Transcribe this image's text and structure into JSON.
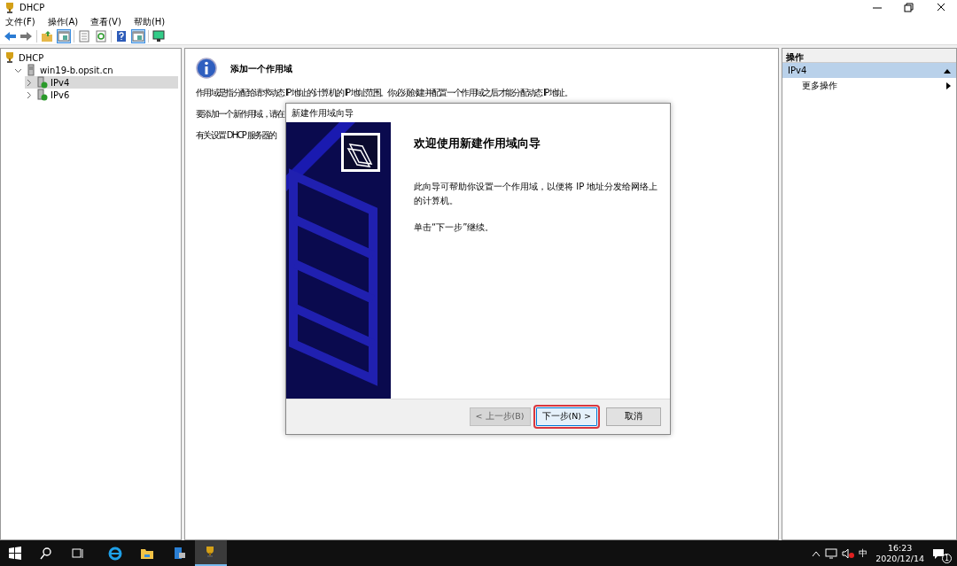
{
  "window": {
    "title": "DHCP"
  },
  "menu": [
    "文件(F)",
    "操作(A)",
    "查看(V)",
    "帮助(H)"
  ],
  "toolbar": [
    {
      "kind": "back",
      "pressed": false
    },
    {
      "kind": "forward",
      "pressed": false
    },
    {
      "kind": "sep"
    },
    {
      "kind": "up",
      "pressed": false
    },
    {
      "kind": "pane",
      "pressed": true
    },
    {
      "kind": "sep"
    },
    {
      "kind": "export",
      "pressed": false
    },
    {
      "kind": "refresh",
      "pressed": false
    },
    {
      "kind": "sep"
    },
    {
      "kind": "help",
      "pressed": false
    },
    {
      "kind": "pane",
      "pressed": true
    },
    {
      "kind": "sep"
    },
    {
      "kind": "monitor",
      "pressed": false
    }
  ],
  "tree": [
    {
      "label": "DHCP",
      "kind": "root",
      "selected": false,
      "children": [
        {
          "label": "win19-b.opsit.cn",
          "kind": "server",
          "selected": false,
          "expanded": true,
          "children": [
            {
              "label": "IPv4",
              "kind": "scope",
              "selected": true,
              "expanded": false
            },
            {
              "label": "IPv6",
              "kind": "scope",
              "selected": false,
              "expanded": false
            }
          ]
        }
      ]
    }
  ],
  "content": {
    "heading": "添加一个作用域",
    "paragraphs": [
      "作用域是指分配给请求动态 IP 地址的计算机的 IP 地址范围。你必须创建并配置一个作用域之后才能分配动态 IP 地址。",
      "要添加一个新作用域，请在",
      "有关设置 DHCP 服务器的"
    ]
  },
  "actions": {
    "header": "操作",
    "section": {
      "label": "IPv4",
      "expanded": true
    },
    "items": [
      "更多操作"
    ]
  },
  "dialog": {
    "title": "新建作用域向导",
    "heading": "欢迎使用新建作用域向导",
    "paragraphs": [
      "此向导可帮助你设置一个作用域，以便将 IP 地址分发给网络上的计算机。",
      "单击“下一步”继续。"
    ],
    "buttons": [
      {
        "label": "< 上一步(B)",
        "disabled": true,
        "highlighted": false
      },
      {
        "label": "下一步(N) >",
        "disabled": false,
        "highlighted": true
      },
      {
        "label": "取消",
        "disabled": false,
        "highlighted": false
      }
    ]
  },
  "taskbar": {
    "apps": [
      {
        "kind": "start",
        "active": false
      },
      {
        "kind": "search",
        "active": false
      },
      {
        "kind": "taskview",
        "active": false
      },
      {
        "kind": "browser",
        "active": false
      },
      {
        "kind": "folder",
        "active": false
      },
      {
        "kind": "server",
        "active": false
      },
      {
        "kind": "dhcp",
        "active": true
      }
    ],
    "ime": "中",
    "time": "16:23",
    "date": "2020/12/14",
    "notifications": "1"
  }
}
